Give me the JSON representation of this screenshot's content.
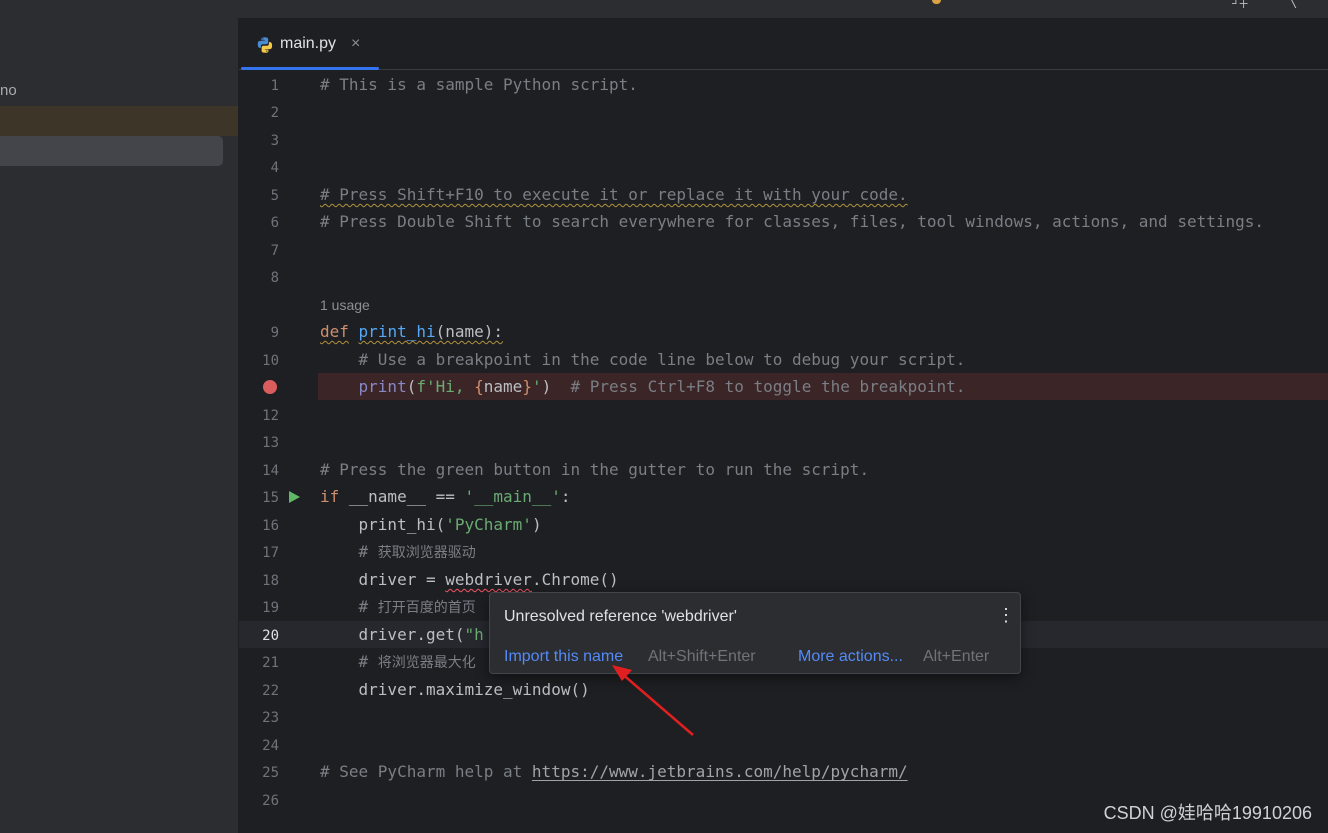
{
  "sidebar": {
    "partial_label": "no"
  },
  "tab": {
    "label": "main.py",
    "close": "×"
  },
  "line_numbers": [
    "1",
    "2",
    "3",
    "4",
    "5",
    "6",
    "7",
    "8",
    "9",
    "10",
    "",
    "12",
    "13",
    "14",
    "15",
    "16",
    "17",
    "18",
    "19",
    "20",
    "21",
    "22",
    "23",
    "24",
    "25",
    "26"
  ],
  "code": {
    "l1": "# This is a sample Python script.",
    "l5": "# Press Shift+F10 to execute it or replace it with your code.",
    "l6": "# Press Double Shift to search everywhere for classes, files, tool windows, actions, and settings.",
    "usage_hint": "1 usage",
    "l9_def": "def",
    "l9_fn": "print_hi",
    "l9_params": "(name):",
    "l10": "    # Use a breakpoint in the code line below to debug your script.",
    "l11_indent": "    ",
    "l11_print": "print",
    "l11_open": "(",
    "l11_fstr1": "f'Hi, ",
    "l11_brace_open": "{",
    "l11_name": "name",
    "l11_brace_close": "}",
    "l11_fstr2": "'",
    "l11_close": ")",
    "l11_comment": "  # Press Ctrl+F8 to toggle the breakpoint.",
    "l14": "# Press the green button in the gutter to run the script.",
    "l15_if": "if",
    "l15_mid": " __name__ == ",
    "l15_str": "'__main__'",
    "l15_colon": ":",
    "l16_a": "    print_hi(",
    "l16_str": "'PyCharm'",
    "l16_b": ")",
    "l17_hash": "    # ",
    "l17_cjk": "获取浏览器驱动",
    "l18_a": "    driver = ",
    "l18_web": "webdriver",
    "l18_b": ".Chrome()",
    "l19_hash": "    # ",
    "l19_cjk": "打开百度的首页",
    "l20_a": "    driver.get(",
    "l20_str": "\"h",
    "l21_hash": "    # ",
    "l21_cjk": "将浏览器最大化",
    "l22": "    driver.maximize_window()",
    "l25_a": "# See PyCharm help at ",
    "l25_link": "https://www.jetbrains.com/help/pycharm/"
  },
  "popup": {
    "title": "Unresolved reference 'webdriver'",
    "more_icon": "⋮",
    "import_label": "Import this name",
    "import_shortcut": "Alt+Shift+Enter",
    "more_label": "More actions...",
    "more_shortcut": "Alt+Enter"
  },
  "watermark": "CSDN @娃哈哈19910206",
  "colors": {
    "accent": "#3574f0",
    "breakpoint": "#db5c5c",
    "run": "#5fb865",
    "arrow": "#e02020"
  }
}
